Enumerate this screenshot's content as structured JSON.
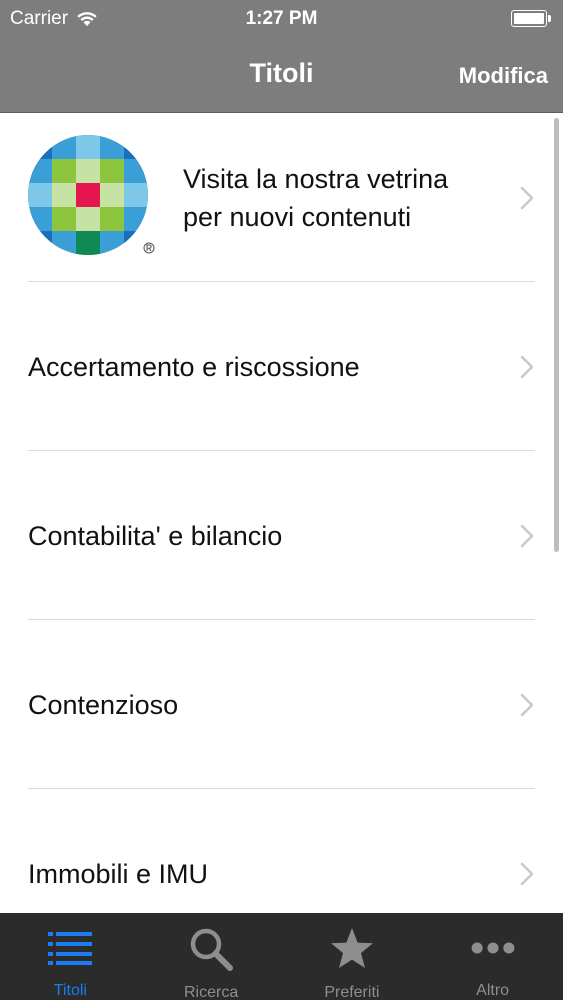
{
  "status_bar": {
    "carrier": "Carrier",
    "time": "1:27 PM"
  },
  "nav": {
    "title": "Titoli",
    "edit_label": "Modifica"
  },
  "list": {
    "featured": {
      "line1": "Visita la nostra vetrina",
      "line2": "per nuovi contenuti"
    },
    "items": [
      {
        "label": "Accertamento e riscossione"
      },
      {
        "label": "Contabilita' e bilancio"
      },
      {
        "label": "Contenzioso"
      },
      {
        "label": "Immobili e IMU"
      }
    ]
  },
  "tabbar": {
    "tabs": [
      {
        "label": "Titoli",
        "icon": "list-icon",
        "active": true
      },
      {
        "label": "Ricerca",
        "icon": "search-icon",
        "active": false
      },
      {
        "label": "Preferiti",
        "icon": "star-icon",
        "active": false
      },
      {
        "label": "Altro",
        "icon": "more-icon",
        "active": false
      }
    ]
  },
  "colors": {
    "header_bg": "#7d7d7d",
    "tab_active": "#1c7cf2",
    "tab_inactive": "#8e8e8e",
    "tabbar_bg": "#2b2b2b"
  }
}
